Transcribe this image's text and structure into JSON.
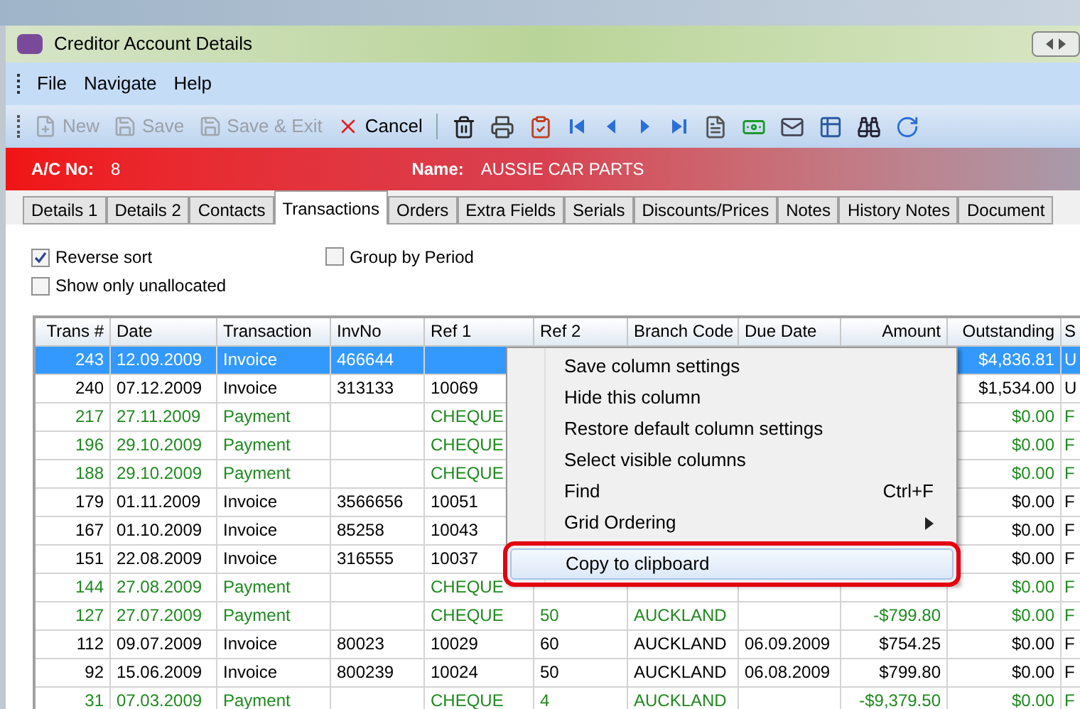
{
  "window": {
    "title": "Creditor Account Details"
  },
  "menu": [
    "File",
    "Navigate",
    "Help"
  ],
  "toolbar": [
    {
      "label": "New",
      "disabled": true
    },
    {
      "label": "Save",
      "disabled": true
    },
    {
      "label": "Save & Exit",
      "disabled": true
    },
    {
      "label": "Cancel",
      "disabled": false
    }
  ],
  "account": {
    "ac_label": "A/C No:",
    "ac_value": "8",
    "name_label": "Name:",
    "name_value": "AUSSIE CAR PARTS"
  },
  "tabs": [
    {
      "label": "Details 1",
      "selected": false
    },
    {
      "label": "Details 2",
      "selected": false
    },
    {
      "label": "Contacts",
      "selected": false
    },
    {
      "label": "Transactions",
      "selected": true
    },
    {
      "label": "Orders",
      "selected": false
    },
    {
      "label": "Extra Fields",
      "selected": false
    },
    {
      "label": "Serials",
      "selected": false
    },
    {
      "label": "Discounts/Prices",
      "selected": false
    },
    {
      "label": "Notes",
      "selected": false
    },
    {
      "label": "History Notes",
      "selected": false
    },
    {
      "label": "Document",
      "selected": false
    }
  ],
  "options": [
    {
      "label": "Reverse sort",
      "checked": true
    },
    {
      "label": "Show only unallocated",
      "checked": false
    },
    {
      "label": "Group by Period",
      "checked": false
    }
  ],
  "table": {
    "columns": [
      "Trans #",
      "Date",
      "Transaction",
      "InvNo",
      "Ref 1",
      "Ref 2",
      "Branch Code",
      "Due Date",
      "Amount",
      "Outstanding",
      "S"
    ],
    "rows": [
      {
        "kind": "invoice",
        "selected": true,
        "cells": [
          "243",
          "12.09.2009",
          "Invoice",
          "466644",
          null,
          null,
          null,
          null,
          null,
          "$4,836.81",
          "U"
        ]
      },
      {
        "kind": "invoice",
        "selected": false,
        "cells": [
          "240",
          "07.12.2009",
          "Invoice",
          "313133",
          "10069",
          null,
          null,
          null,
          null,
          "$1,534.00",
          "U"
        ]
      },
      {
        "kind": "payment",
        "selected": false,
        "cells": [
          "217",
          "27.11.2009",
          "Payment",
          null,
          "CHEQUE",
          null,
          null,
          null,
          null,
          "$0.00",
          "F"
        ]
      },
      {
        "kind": "payment",
        "selected": false,
        "cells": [
          "196",
          "29.10.2009",
          "Payment",
          null,
          "CHEQUE",
          null,
          null,
          null,
          null,
          "$0.00",
          "F"
        ]
      },
      {
        "kind": "payment",
        "selected": false,
        "cells": [
          "188",
          "29.10.2009",
          "Payment",
          null,
          "CHEQUE",
          null,
          null,
          null,
          null,
          "$0.00",
          "F"
        ]
      },
      {
        "kind": "invoice",
        "selected": false,
        "cells": [
          "179",
          "01.11.2009",
          "Invoice",
          "3566656",
          "10051",
          null,
          null,
          null,
          null,
          "$0.00",
          "F"
        ]
      },
      {
        "kind": "invoice",
        "selected": false,
        "cells": [
          "167",
          "01.10.2009",
          "Invoice",
          "85258",
          "10043",
          null,
          null,
          null,
          null,
          "$0.00",
          "F"
        ]
      },
      {
        "kind": "invoice",
        "selected": false,
        "cells": [
          "151",
          "22.08.2009",
          "Invoice",
          "316555",
          "10037",
          null,
          null,
          null,
          null,
          "$0.00",
          "F"
        ]
      },
      {
        "kind": "payment",
        "selected": false,
        "cells": [
          "144",
          "27.08.2009",
          "Payment",
          null,
          "CHEQUE",
          null,
          null,
          null,
          null,
          "$0.00",
          "F"
        ]
      },
      {
        "kind": "payment",
        "selected": false,
        "cells": [
          "127",
          "27.07.2009",
          "Payment",
          null,
          "CHEQUE",
          "50",
          "AUCKLAND",
          null,
          "-$799.80",
          "$0.00",
          "F"
        ]
      },
      {
        "kind": "invoice",
        "selected": false,
        "cells": [
          "112",
          "09.07.2009",
          "Invoice",
          "80023",
          "10029",
          "60",
          "AUCKLAND",
          "06.09.2009",
          "$754.25",
          "$0.00",
          "F"
        ]
      },
      {
        "kind": "invoice",
        "selected": false,
        "cells": [
          "92",
          "15.06.2009",
          "Invoice",
          "800239",
          "10024",
          "50",
          "AUCKLAND",
          "06.08.2009",
          "$799.80",
          "$0.00",
          "F"
        ]
      },
      {
        "kind": "payment",
        "selected": false,
        "cells": [
          "31",
          "07.03.2009",
          "Payment",
          null,
          "CHEQUE",
          "4",
          "AUCKLAND",
          null,
          "-$9,379.50",
          "$0.00",
          "F"
        ]
      }
    ]
  },
  "context_menu": [
    {
      "kind": "item",
      "label": "Save column settings",
      "highlighted": false
    },
    {
      "kind": "item",
      "label": "Hide this column",
      "highlighted": false
    },
    {
      "kind": "item",
      "label": "Restore default column settings",
      "highlighted": false
    },
    {
      "kind": "item",
      "label": "Select visible columns",
      "highlighted": false
    },
    {
      "kind": "item",
      "label": "Find",
      "shortcut": "Ctrl+F",
      "highlighted": false
    },
    {
      "kind": "submenu",
      "label": "Grid Ordering",
      "highlighted": false
    },
    {
      "kind": "separator"
    },
    {
      "kind": "item",
      "label": "Copy to clipboard",
      "highlighted": true
    }
  ]
}
